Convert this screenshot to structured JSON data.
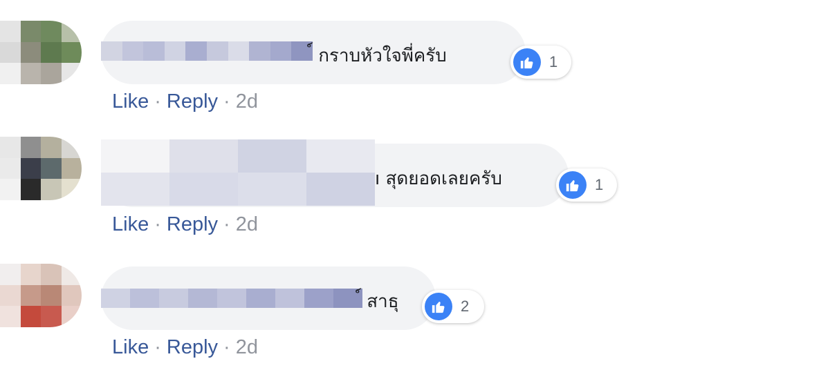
{
  "comments": [
    {
      "text": "์ กราบหัวใจพี่ครับ",
      "reaction_count": "1",
      "actions": {
        "like": "Like",
        "reply": "Reply",
        "time": "2d"
      }
    },
    {
      "text": "ı สุดยอดเลยครับ",
      "reaction_count": "1",
      "actions": {
        "like": "Like",
        "reply": "Reply",
        "time": "2d"
      }
    },
    {
      "text": "์ สาธุ",
      "reaction_count": "2",
      "actions": {
        "like": "Like",
        "reply": "Reply",
        "time": "2d"
      }
    }
  ],
  "separator": "·",
  "colors": {
    "like_blue": "#3b82f6",
    "link": "#385898",
    "meta": "#90949c",
    "bubble": "#f2f3f5"
  },
  "icons": {
    "reaction": "thumbs-up-icon"
  }
}
